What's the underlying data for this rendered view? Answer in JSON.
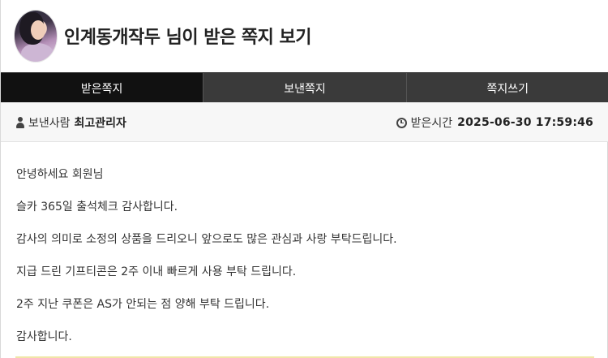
{
  "header": {
    "title": "인계동개작두 님이 받은 쪽지 보기"
  },
  "tabs": [
    {
      "label": "받은쪽지",
      "active": true
    },
    {
      "label": "보낸쪽지",
      "active": false
    },
    {
      "label": "쪽지쓰기",
      "active": false
    }
  ],
  "meta": {
    "sender_label": "보낸사람",
    "sender_name": "최고관리자",
    "received_label": "받은시간",
    "received_time": "2025-06-30 17:59:46"
  },
  "message": {
    "lines": [
      "안녕하세요 회원님",
      "슬카 365일 출석체크 감사합니다.",
      "감사의 의미로 소정의 상품을 드리오니 앞으로도 많은 관심과 사랑 부탁드립니다.",
      "지급 드린 기프티콘은 2주 이내 빠르게 사용 부탁 드립니다.",
      "2주 지난 쿠폰은 AS가 안되는 점 양해 부탁 드립니다.",
      "감사합니다."
    ]
  },
  "icons": {
    "sender": "user-icon",
    "received": "clock-icon"
  }
}
